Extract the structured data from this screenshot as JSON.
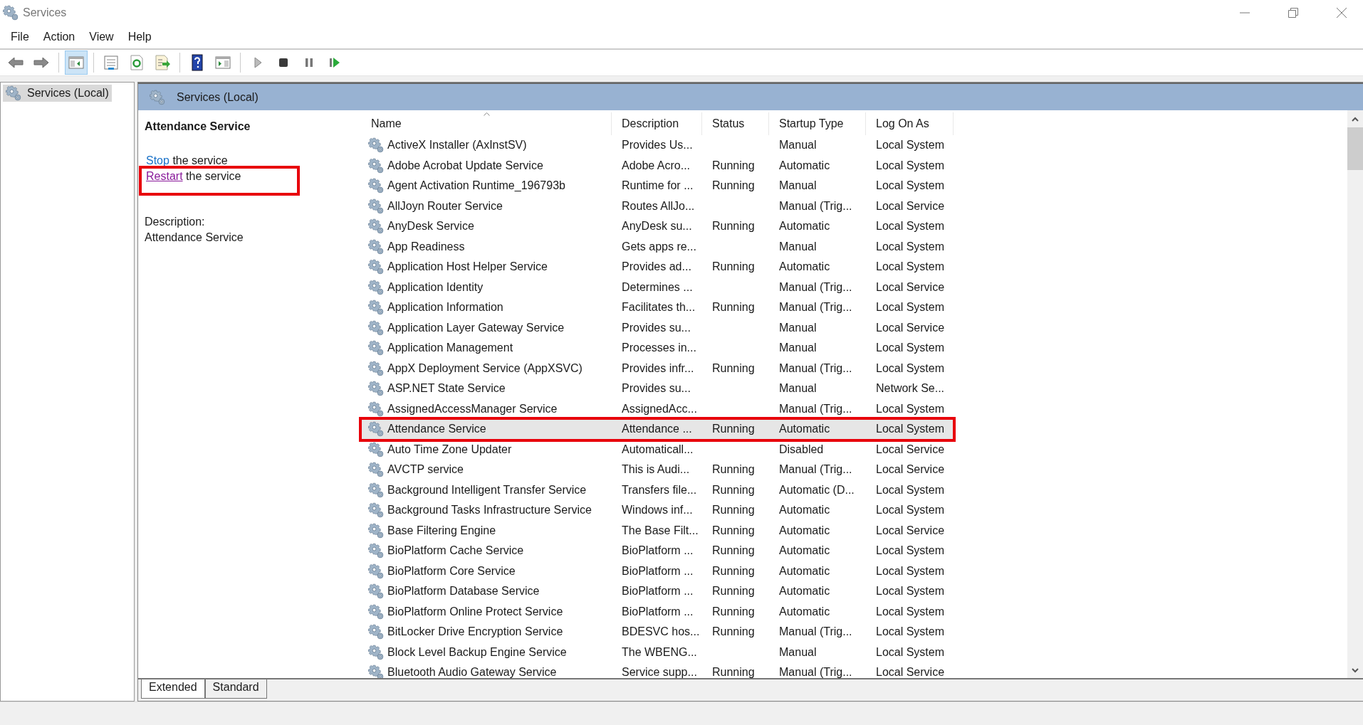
{
  "window": {
    "title": "Services"
  },
  "menu": [
    "File",
    "Action",
    "View",
    "Help"
  ],
  "toolbar": [
    {
      "kind": "back",
      "selected": false
    },
    {
      "kind": "forward",
      "selected": false
    },
    {
      "kind": "sep"
    },
    {
      "kind": "tree",
      "selected": true
    },
    {
      "kind": "sep"
    },
    {
      "kind": "properties",
      "selected": false
    },
    {
      "kind": "refresh",
      "selected": false
    },
    {
      "kind": "export",
      "selected": false
    },
    {
      "kind": "sep"
    },
    {
      "kind": "help",
      "selected": false
    },
    {
      "kind": "actionpane",
      "selected": false
    },
    {
      "kind": "sep"
    },
    {
      "kind": "start",
      "selected": false
    },
    {
      "kind": "stop",
      "selected": false
    },
    {
      "kind": "pause",
      "selected": false
    },
    {
      "kind": "resume",
      "selected": false
    }
  ],
  "tree": {
    "items": [
      {
        "label": "Services (Local)",
        "selected": true
      }
    ]
  },
  "header": {
    "title": "Services (Local)"
  },
  "details": {
    "name": "Attendance Service",
    "actions": [
      {
        "link": "Stop",
        "text": "the service",
        "visited": false,
        "highlighted": false
      },
      {
        "link": "Restart",
        "text": "the service",
        "visited": true,
        "highlighted": true
      }
    ],
    "description_label": "Description:",
    "description": "Attendance Service"
  },
  "table": {
    "columns": [
      {
        "label": "Name",
        "sorted": true
      },
      {
        "label": "Description",
        "sorted": false
      },
      {
        "label": "Status",
        "sorted": false
      },
      {
        "label": "Startup Type",
        "sorted": false
      },
      {
        "label": "Log On As",
        "sorted": false
      }
    ],
    "rows": [
      {
        "cells": [
          "ActiveX Installer (AxInstSV)",
          "Provides Us...",
          "",
          "Manual",
          "Local System"
        ],
        "selected": false,
        "highlighted": false
      },
      {
        "cells": [
          "Adobe Acrobat Update Service",
          "Adobe Acro...",
          "Running",
          "Automatic",
          "Local System"
        ],
        "selected": false,
        "highlighted": false
      },
      {
        "cells": [
          "Agent Activation Runtime_196793b",
          "Runtime for ...",
          "Running",
          "Manual",
          "Local System"
        ],
        "selected": false,
        "highlighted": false
      },
      {
        "cells": [
          "AllJoyn Router Service",
          "Routes AllJo...",
          "",
          "Manual (Trig...",
          "Local Service"
        ],
        "selected": false,
        "highlighted": false
      },
      {
        "cells": [
          "AnyDesk Service",
          "AnyDesk su...",
          "Running",
          "Automatic",
          "Local System"
        ],
        "selected": false,
        "highlighted": false
      },
      {
        "cells": [
          "App Readiness",
          "Gets apps re...",
          "",
          "Manual",
          "Local System"
        ],
        "selected": false,
        "highlighted": false
      },
      {
        "cells": [
          "Application Host Helper Service",
          "Provides ad...",
          "Running",
          "Automatic",
          "Local System"
        ],
        "selected": false,
        "highlighted": false
      },
      {
        "cells": [
          "Application Identity",
          "Determines ...",
          "",
          "Manual (Trig...",
          "Local Service"
        ],
        "selected": false,
        "highlighted": false
      },
      {
        "cells": [
          "Application Information",
          "Facilitates th...",
          "Running",
          "Manual (Trig...",
          "Local System"
        ],
        "selected": false,
        "highlighted": false
      },
      {
        "cells": [
          "Application Layer Gateway Service",
          "Provides su...",
          "",
          "Manual",
          "Local Service"
        ],
        "selected": false,
        "highlighted": false
      },
      {
        "cells": [
          "Application Management",
          "Processes in...",
          "",
          "Manual",
          "Local System"
        ],
        "selected": false,
        "highlighted": false
      },
      {
        "cells": [
          "AppX Deployment Service (AppXSVC)",
          "Provides infr...",
          "Running",
          "Manual (Trig...",
          "Local System"
        ],
        "selected": false,
        "highlighted": false
      },
      {
        "cells": [
          "ASP.NET State Service",
          "Provides su...",
          "",
          "Manual",
          "Network Se..."
        ],
        "selected": false,
        "highlighted": false
      },
      {
        "cells": [
          "AssignedAccessManager Service",
          "AssignedAcc...",
          "",
          "Manual (Trig...",
          "Local System"
        ],
        "selected": false,
        "highlighted": false
      },
      {
        "cells": [
          "Attendance Service",
          "Attendance ...",
          "Running",
          "Automatic",
          "Local System"
        ],
        "selected": true,
        "highlighted": true
      },
      {
        "cells": [
          "Auto Time Zone Updater",
          "Automaticall...",
          "",
          "Disabled",
          "Local Service"
        ],
        "selected": false,
        "highlighted": false
      },
      {
        "cells": [
          "AVCTP service",
          "This is Audi...",
          "Running",
          "Manual (Trig...",
          "Local Service"
        ],
        "selected": false,
        "highlighted": false
      },
      {
        "cells": [
          "Background Intelligent Transfer Service",
          "Transfers file...",
          "Running",
          "Automatic (D...",
          "Local System"
        ],
        "selected": false,
        "highlighted": false
      },
      {
        "cells": [
          "Background Tasks Infrastructure Service",
          "Windows inf...",
          "Running",
          "Automatic",
          "Local System"
        ],
        "selected": false,
        "highlighted": false
      },
      {
        "cells": [
          "Base Filtering Engine",
          "The Base Filt...",
          "Running",
          "Automatic",
          "Local Service"
        ],
        "selected": false,
        "highlighted": false
      },
      {
        "cells": [
          "BioPlatform Cache Service",
          "BioPlatform ...",
          "Running",
          "Automatic",
          "Local System"
        ],
        "selected": false,
        "highlighted": false
      },
      {
        "cells": [
          "BioPlatform Core Service",
          "BioPlatform ...",
          "Running",
          "Automatic",
          "Local System"
        ],
        "selected": false,
        "highlighted": false
      },
      {
        "cells": [
          "BioPlatform Database Service",
          "BioPlatform ...",
          "Running",
          "Automatic",
          "Local System"
        ],
        "selected": false,
        "highlighted": false
      },
      {
        "cells": [
          "BioPlatform Online Protect Service",
          "BioPlatform ...",
          "Running",
          "Automatic",
          "Local System"
        ],
        "selected": false,
        "highlighted": false
      },
      {
        "cells": [
          "BitLocker Drive Encryption Service",
          "BDESVC hos...",
          "Running",
          "Manual (Trig...",
          "Local System"
        ],
        "selected": false,
        "highlighted": false
      },
      {
        "cells": [
          "Block Level Backup Engine Service",
          "The WBENG...",
          "",
          "Manual",
          "Local System"
        ],
        "selected": false,
        "highlighted": false
      },
      {
        "cells": [
          "Bluetooth Audio Gateway Service",
          "Service supp...",
          "Running",
          "Manual (Trig...",
          "Local Service"
        ],
        "selected": false,
        "highlighted": false
      }
    ]
  },
  "tabs": [
    {
      "label": "Extended",
      "selected": true
    },
    {
      "label": "Standard",
      "selected": false
    }
  ]
}
